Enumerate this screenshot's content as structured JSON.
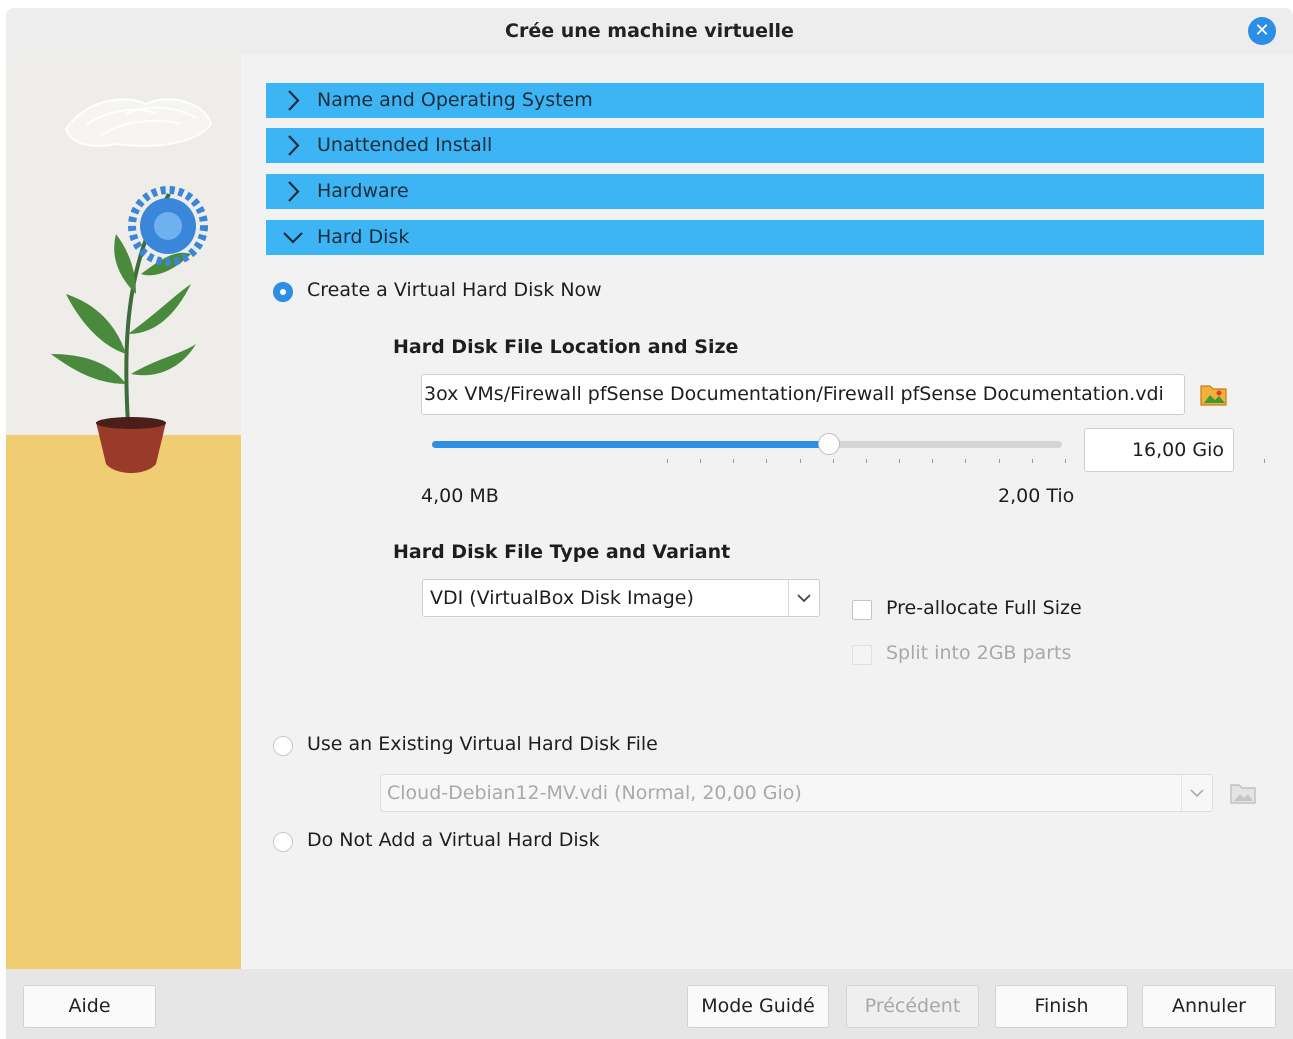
{
  "window": {
    "title": "Crée une machine virtuelle"
  },
  "sections": [
    {
      "label": "Name and Operating System",
      "expanded": false
    },
    {
      "label": "Unattended Install",
      "expanded": false
    },
    {
      "label": "Hardware",
      "expanded": false
    },
    {
      "label": "Hard Disk",
      "expanded": true
    }
  ],
  "hard_disk": {
    "option_create": {
      "label": "Create a Virtual Hard Disk Now",
      "selected": true
    },
    "location_heading": "Hard Disk File Location and Size",
    "file_path": "3ox VMs/Firewall pfSense Documentation/Firewall pfSense Documentation.vdi",
    "size_value": "16,00 Gio",
    "slider": {
      "min_label": "4,00 MB",
      "max_label": "2,00 Tio",
      "position_fraction": 0.63
    },
    "type_heading": "Hard Disk File Type and Variant",
    "type_selected": "VDI (VirtualBox Disk Image)",
    "preallocate": {
      "label": "Pre-allocate Full Size",
      "checked": false
    },
    "split": {
      "label": "Split into 2GB parts",
      "checked": false,
      "enabled": false
    },
    "option_existing": {
      "label": "Use an Existing Virtual Hard Disk File",
      "selected": false
    },
    "existing_selected": "Cloud-Debian12-MV.vdi (Normal, 20,00 Gio)",
    "option_none": {
      "label": "Do Not Add a Virtual Hard Disk",
      "selected": false
    }
  },
  "footer": {
    "help": "Aide",
    "guided_mode": "Mode Guidé",
    "previous": "Précédent",
    "finish": "Finish",
    "cancel": "Annuler"
  },
  "colors": {
    "accent": "#2d8ee6",
    "section_header": "#3db5f5",
    "floor": "#f0cd72"
  }
}
